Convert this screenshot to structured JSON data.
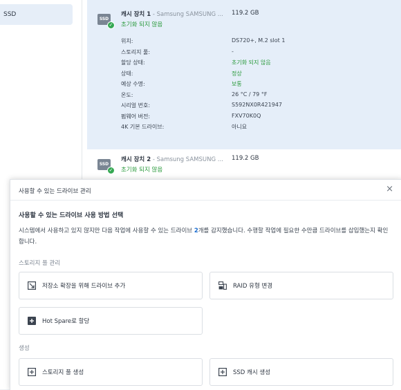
{
  "sidebar": {
    "active_item": "SSD"
  },
  "drives": [
    {
      "name": "캐시 장치 1",
      "model": " - Samsung SAMSUNG ...",
      "capacity": "119.2 GB",
      "status": "초기화 되지 않음",
      "properties": [
        {
          "label": "위치:",
          "value": "DS720+, M.2 slot 1"
        },
        {
          "label": "스토리지 풀:",
          "value": "-"
        },
        {
          "label": "할당 상태:",
          "value": "초기화 되지 않음",
          "highlight": true
        },
        {
          "label": "상태:",
          "value": "정상",
          "highlight": true
        },
        {
          "label": "예상 수명:",
          "value": "보통",
          "highlight": true
        },
        {
          "label": "온도:",
          "value": "26 °C / 79 °F"
        },
        {
          "label": "시리얼 번호:",
          "value": "S592NX0R421947"
        },
        {
          "label": "펌웨어 버전:",
          "value": "FXV70K0Q"
        },
        {
          "label": "4K 기본 드라이브:",
          "value": "아니요"
        }
      ]
    },
    {
      "name": "캐시 장치 2",
      "model": " - Samsung SAMSUNG ...",
      "capacity": "119.2 GB",
      "status": "초기화 되지 않음"
    }
  ],
  "icons": {
    "ssd_label": "SSD",
    "check_glyph": "✓",
    "close_glyph": "×"
  },
  "dialog": {
    "title": "사용할 수 있는 드라이브 관리",
    "heading": "사용할 수 있는 드라이브 사용 방법 선택",
    "description_before": "시스템에서 사용하고 있지 않지만 다음 작업에 사용할 수 있는 드라이브 ",
    "drive_count": "2",
    "description_after": "개를 감지했습니다. 수행할 작업에 필요한 수만큼 드라이브를 삽입했는지 확인합니다.",
    "sections": {
      "pool_management": "스토리지 풀 관리",
      "create": "생성"
    },
    "options": {
      "add_drive": "저장소 확장을 위해 드라이브 추가",
      "change_raid": "RAID 유형 변경",
      "hot_spare": "Hot Spare로 할당",
      "create_pool": "스토리지 풀 생성",
      "create_ssd_cache": "SSD 캐시 생성"
    }
  },
  "colors": {
    "accent_green": "#2a9a3c",
    "selected_row": "#e5eef9",
    "link_blue": "#1a6ccf"
  }
}
